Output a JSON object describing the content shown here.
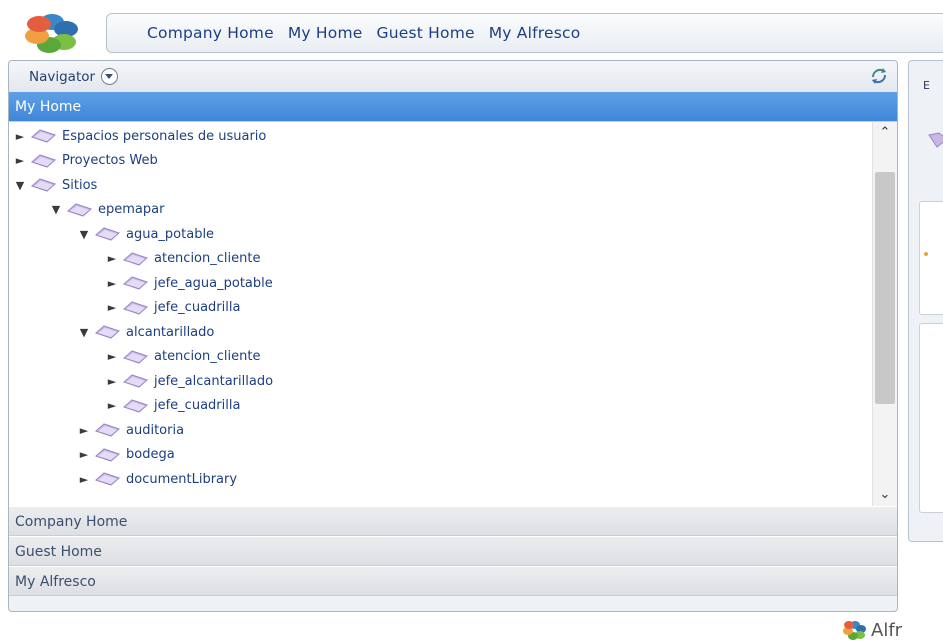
{
  "topnav": {
    "links": [
      "Company Home",
      "My Home",
      "Guest Home",
      "My Alfresco"
    ]
  },
  "navigator": {
    "title": "Navigator",
    "active_section": "My Home",
    "tree": [
      {
        "label": "Espacios personales de usuario",
        "level": 0,
        "expanded": false
      },
      {
        "label": "Proyectos Web",
        "level": 0,
        "expanded": false
      },
      {
        "label": "Sitios",
        "level": 0,
        "expanded": true
      },
      {
        "label": "epemapar",
        "level": 1,
        "expanded": true
      },
      {
        "label": "agua_potable",
        "level": 2,
        "expanded": true
      },
      {
        "label": "atencion_cliente",
        "level": 3,
        "expanded": false
      },
      {
        "label": "jefe_agua_potable",
        "level": 3,
        "expanded": false
      },
      {
        "label": "jefe_cuadrilla",
        "level": 3,
        "expanded": false
      },
      {
        "label": "alcantarillado",
        "level": 2,
        "expanded": true
      },
      {
        "label": "atencion_cliente",
        "level": 3,
        "expanded": false
      },
      {
        "label": "jefe_alcantarillado",
        "level": 3,
        "expanded": false
      },
      {
        "label": "jefe_cuadrilla",
        "level": 3,
        "expanded": false
      },
      {
        "label": "auditoria",
        "level": 2,
        "expanded": false
      },
      {
        "label": "bodega",
        "level": 2,
        "expanded": false
      },
      {
        "label": "documentLibrary",
        "level": 2,
        "expanded": false
      }
    ],
    "sections": [
      "Company Home",
      "Guest Home",
      "My Alfresco"
    ]
  },
  "right_panel": {
    "header_letter": "E"
  },
  "footer": {
    "brand": "Alfr"
  },
  "icons": {
    "logo": "alfresco-logo-icon",
    "dropdown": "chevron-down-circle-icon",
    "refresh": "refresh-icon",
    "folder": "folder-icon",
    "expand": "triangle-right-icon",
    "collapse": "triangle-down-icon"
  },
  "colors": {
    "active_section_bg": "#4a8fdd",
    "link": "#1b3f86",
    "logo_blue": "#3b88c9",
    "logo_green": "#7bc043",
    "logo_orange": "#f0a040"
  }
}
